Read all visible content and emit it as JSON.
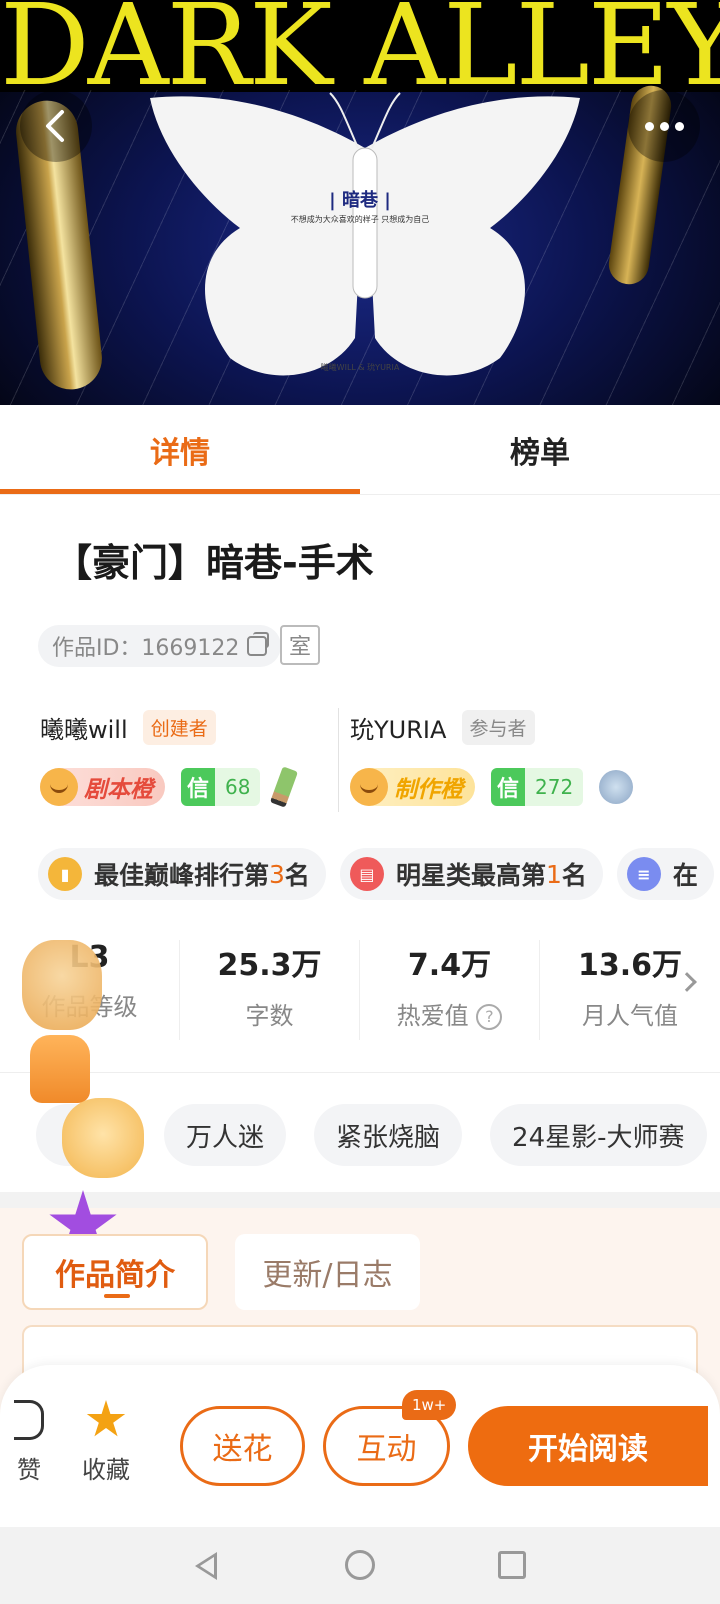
{
  "cover": {
    "title_art": "DARK ALLEY",
    "work_name": "| 暗巷 |",
    "slogan": "不想成为大众喜欢的样子 只想成为自己",
    "credit": "曦曦WILL & 玧YURIA"
  },
  "tabs": [
    "详情",
    "榜单"
  ],
  "work": {
    "title": "【豪门】暗巷-手术",
    "id_text": "作品ID：1669122",
    "room_badge": "室"
  },
  "authors": [
    {
      "name": "曦曦will",
      "role": "创建者",
      "level": "剧本橙",
      "credit_label": "信",
      "credit": "68",
      "accessory": "pencil-icon"
    },
    {
      "name": "玧YURIA",
      "role": "参与者",
      "level": "制作橙",
      "credit_label": "信",
      "credit": "272",
      "accessory": "dog-icon"
    }
  ],
  "ranks": [
    {
      "pre": "最佳巅峰排行第",
      "num": "3",
      "post": "名",
      "icon": "chart-icon",
      "color": "#f4b63a"
    },
    {
      "pre": "明星类最高第",
      "num": "1",
      "post": "名",
      "icon": "calendar-icon",
      "color": "#ef5a5a"
    },
    {
      "pre": "在",
      "num": "",
      "post": "",
      "icon": "doc-icon",
      "color": "#7a8cf0"
    }
  ],
  "stats": [
    {
      "value": "L3",
      "label": "作品等级"
    },
    {
      "value": "25.3万",
      "label": "字数"
    },
    {
      "value": "7.4万",
      "label": "热爱值",
      "help": "?"
    },
    {
      "value": "13.6万",
      "label": "月人气值"
    }
  ],
  "tags": [
    "",
    "万人迷",
    "紧张烧脑",
    "24星影-大师赛"
  ],
  "intro_tabs": [
    "作品简介",
    "更新/日志"
  ],
  "actions": {
    "like_label": "赞",
    "fav_label": "收藏",
    "flower": "送花",
    "interact": "互动",
    "interact_badge": "1w+",
    "read": "开始阅读"
  },
  "colors": {
    "accent": "#ea6b16",
    "credit_green": "#4cc95b"
  }
}
